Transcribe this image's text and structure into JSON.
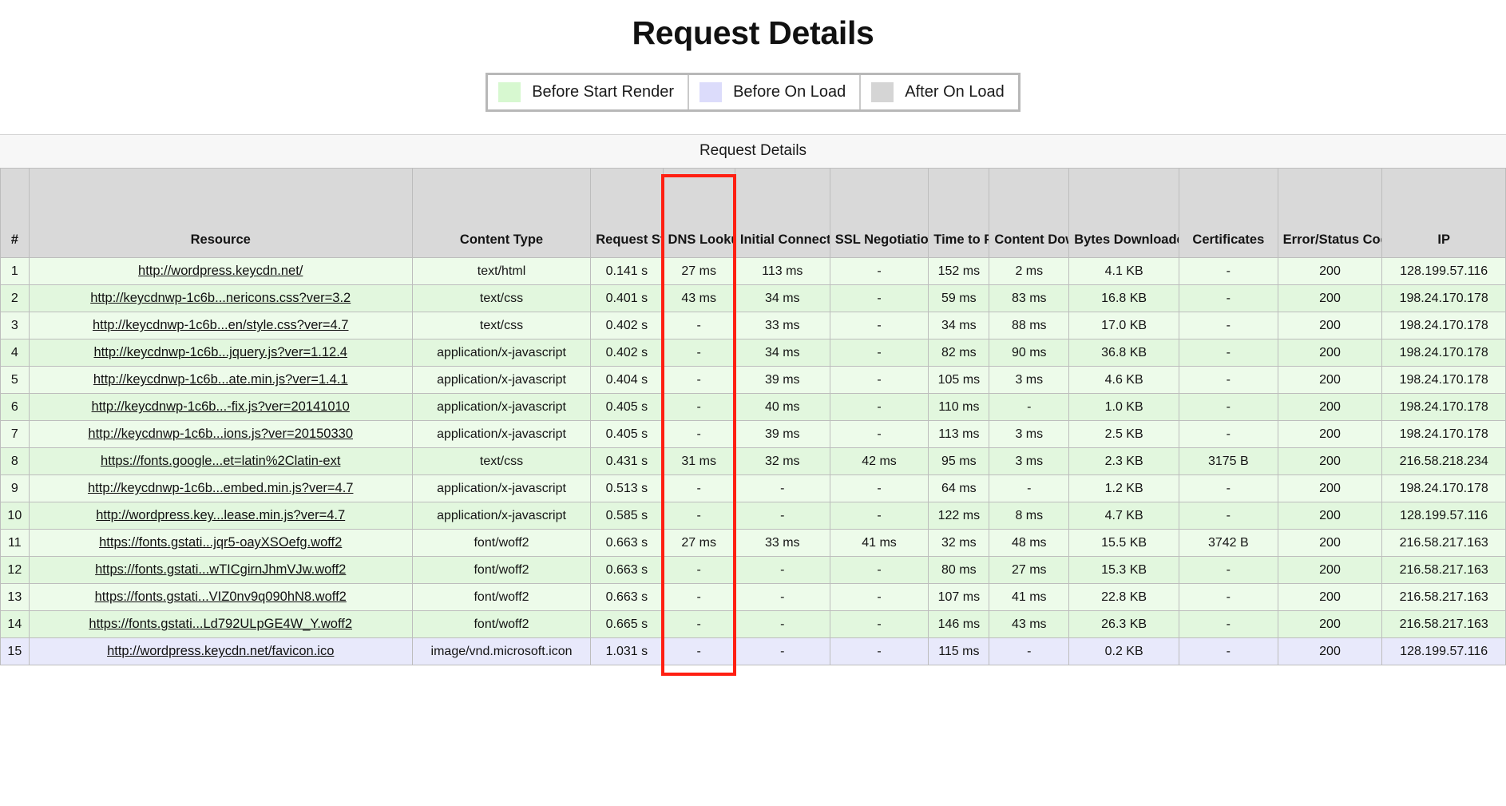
{
  "page": {
    "title": "Request Details"
  },
  "legend": {
    "items": [
      {
        "label": "Before Start Render",
        "color": "#d7f8d0"
      },
      {
        "label": "Before On Load",
        "color": "#dcdcfb"
      },
      {
        "label": "After On Load",
        "color": "#d5d5d5"
      }
    ]
  },
  "table": {
    "caption": "Request Details",
    "columns": [
      "#",
      "Resource",
      "Content Type",
      "Request Start",
      "DNS Lookup",
      "Initial Connection",
      "SSL Negotiation",
      "Time to First Byte",
      "Content Download",
      "Bytes Downloaded",
      "Certificates",
      "Error/Status Code",
      "IP"
    ],
    "highlight": {
      "column": "DNS Lookup",
      "color": "#ff1f12"
    },
    "rows": [
      {
        "num": "1",
        "resource": "http://wordpress.keycdn.net/",
        "content_type": "text/html",
        "request_start": "0.141 s",
        "dns_lookup": "27 ms",
        "initial_connection": "113 ms",
        "ssl_negotiation": "-",
        "ttfb": "152 ms",
        "content_download": "2 ms",
        "bytes_downloaded": "4.1 KB",
        "certificates": "-",
        "status_code": "200",
        "ip": "128.199.57.116",
        "band": "green-alt"
      },
      {
        "num": "2",
        "resource": "http://keycdnwp-1c6b...nericons.css?ver=3.2",
        "content_type": "text/css",
        "request_start": "0.401 s",
        "dns_lookup": "43 ms",
        "initial_connection": "34 ms",
        "ssl_negotiation": "-",
        "ttfb": "59 ms",
        "content_download": "83 ms",
        "bytes_downloaded": "16.8 KB",
        "certificates": "-",
        "status_code": "200",
        "ip": "198.24.170.178",
        "band": "green"
      },
      {
        "num": "3",
        "resource": "http://keycdnwp-1c6b...en/style.css?ver=4.7",
        "content_type": "text/css",
        "request_start": "0.402 s",
        "dns_lookup": "-",
        "initial_connection": "33 ms",
        "ssl_negotiation": "-",
        "ttfb": "34 ms",
        "content_download": "88 ms",
        "bytes_downloaded": "17.0 KB",
        "certificates": "-",
        "status_code": "200",
        "ip": "198.24.170.178",
        "band": "green-alt"
      },
      {
        "num": "4",
        "resource": "http://keycdnwp-1c6b...jquery.js?ver=1.12.4",
        "content_type": "application/x-javascript",
        "request_start": "0.402 s",
        "dns_lookup": "-",
        "initial_connection": "34 ms",
        "ssl_negotiation": "-",
        "ttfb": "82 ms",
        "content_download": "90 ms",
        "bytes_downloaded": "36.8 KB",
        "certificates": "-",
        "status_code": "200",
        "ip": "198.24.170.178",
        "band": "green"
      },
      {
        "num": "5",
        "resource": "http://keycdnwp-1c6b...ate.min.js?ver=1.4.1",
        "content_type": "application/x-javascript",
        "request_start": "0.404 s",
        "dns_lookup": "-",
        "initial_connection": "39 ms",
        "ssl_negotiation": "-",
        "ttfb": "105 ms",
        "content_download": "3 ms",
        "bytes_downloaded": "4.6 KB",
        "certificates": "-",
        "status_code": "200",
        "ip": "198.24.170.178",
        "band": "green-alt"
      },
      {
        "num": "6",
        "resource": "http://keycdnwp-1c6b...-fix.js?ver=20141010",
        "content_type": "application/x-javascript",
        "request_start": "0.405 s",
        "dns_lookup": "-",
        "initial_connection": "40 ms",
        "ssl_negotiation": "-",
        "ttfb": "110 ms",
        "content_download": "-",
        "bytes_downloaded": "1.0 KB",
        "certificates": "-",
        "status_code": "200",
        "ip": "198.24.170.178",
        "band": "green"
      },
      {
        "num": "7",
        "resource": "http://keycdnwp-1c6b...ions.js?ver=20150330",
        "content_type": "application/x-javascript",
        "request_start": "0.405 s",
        "dns_lookup": "-",
        "initial_connection": "39 ms",
        "ssl_negotiation": "-",
        "ttfb": "113 ms",
        "content_download": "3 ms",
        "bytes_downloaded": "2.5 KB",
        "certificates": "-",
        "status_code": "200",
        "ip": "198.24.170.178",
        "band": "green-alt"
      },
      {
        "num": "8",
        "resource": "https://fonts.google...et=latin%2Clatin-ext",
        "content_type": "text/css",
        "request_start": "0.431 s",
        "dns_lookup": "31 ms",
        "initial_connection": "32 ms",
        "ssl_negotiation": "42 ms",
        "ttfb": "95 ms",
        "content_download": "3 ms",
        "bytes_downloaded": "2.3 KB",
        "certificates": "3175 B",
        "status_code": "200",
        "ip": "216.58.218.234",
        "band": "green"
      },
      {
        "num": "9",
        "resource": "http://keycdnwp-1c6b...embed.min.js?ver=4.7",
        "content_type": "application/x-javascript",
        "request_start": "0.513 s",
        "dns_lookup": "-",
        "initial_connection": "-",
        "ssl_negotiation": "-",
        "ttfb": "64 ms",
        "content_download": "-",
        "bytes_downloaded": "1.2 KB",
        "certificates": "-",
        "status_code": "200",
        "ip": "198.24.170.178",
        "band": "green-alt"
      },
      {
        "num": "10",
        "resource": "http://wordpress.key...lease.min.js?ver=4.7",
        "content_type": "application/x-javascript",
        "request_start": "0.585 s",
        "dns_lookup": "-",
        "initial_connection": "-",
        "ssl_negotiation": "-",
        "ttfb": "122 ms",
        "content_download": "8 ms",
        "bytes_downloaded": "4.7 KB",
        "certificates": "-",
        "status_code": "200",
        "ip": "128.199.57.116",
        "band": "green"
      },
      {
        "num": "11",
        "resource": "https://fonts.gstati...jqr5-oayXSOefg.woff2",
        "content_type": "font/woff2",
        "request_start": "0.663 s",
        "dns_lookup": "27 ms",
        "initial_connection": "33 ms",
        "ssl_negotiation": "41 ms",
        "ttfb": "32 ms",
        "content_download": "48 ms",
        "bytes_downloaded": "15.5 KB",
        "certificates": "3742 B",
        "status_code": "200",
        "ip": "216.58.217.163",
        "band": "green-alt"
      },
      {
        "num": "12",
        "resource": "https://fonts.gstati...wTICgirnJhmVJw.woff2",
        "content_type": "font/woff2",
        "request_start": "0.663 s",
        "dns_lookup": "-",
        "initial_connection": "-",
        "ssl_negotiation": "-",
        "ttfb": "80 ms",
        "content_download": "27 ms",
        "bytes_downloaded": "15.3 KB",
        "certificates": "-",
        "status_code": "200",
        "ip": "216.58.217.163",
        "band": "green"
      },
      {
        "num": "13",
        "resource": "https://fonts.gstati...VIZ0nv9q090hN8.woff2",
        "content_type": "font/woff2",
        "request_start": "0.663 s",
        "dns_lookup": "-",
        "initial_connection": "-",
        "ssl_negotiation": "-",
        "ttfb": "107 ms",
        "content_download": "41 ms",
        "bytes_downloaded": "22.8 KB",
        "certificates": "-",
        "status_code": "200",
        "ip": "216.58.217.163",
        "band": "green-alt"
      },
      {
        "num": "14",
        "resource": "https://fonts.gstati...Ld792ULpGE4W_Y.woff2",
        "content_type": "font/woff2",
        "request_start": "0.665 s",
        "dns_lookup": "-",
        "initial_connection": "-",
        "ssl_negotiation": "-",
        "ttfb": "146 ms",
        "content_download": "43 ms",
        "bytes_downloaded": "26.3 KB",
        "certificates": "-",
        "status_code": "200",
        "ip": "216.58.217.163",
        "band": "green"
      },
      {
        "num": "15",
        "resource": "http://wordpress.keycdn.net/favicon.ico",
        "content_type": "image/vnd.microsoft.icon",
        "request_start": "1.031 s",
        "dns_lookup": "-",
        "initial_connection": "-",
        "ssl_negotiation": "-",
        "ttfb": "115 ms",
        "content_download": "-",
        "bytes_downloaded": "0.2 KB",
        "certificates": "-",
        "status_code": "200",
        "ip": "128.199.57.116",
        "band": "blue"
      }
    ]
  }
}
